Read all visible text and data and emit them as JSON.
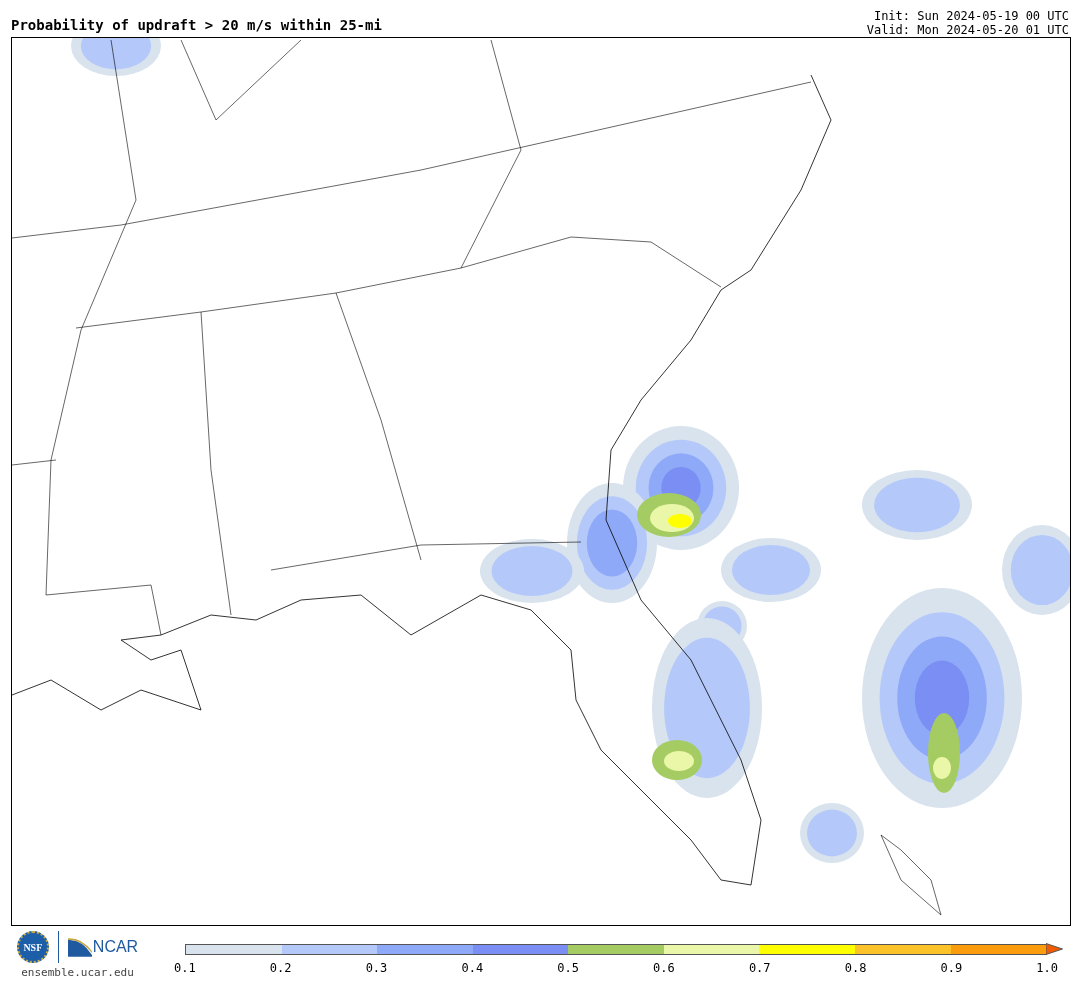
{
  "title": "Probability of updraft > 20 m/s within 25-mi",
  "init": "Init: Sun 2024-05-19 00 UTC",
  "valid": "Valid: Mon 2024-05-20 01 UTC",
  "footer": {
    "nsf_logo": "NSF",
    "ncar_logo": "NCAR",
    "url": "ensemble.ucar.edu"
  },
  "colorbar": {
    "bins": [
      {
        "color": "#d8e3ee"
      },
      {
        "color": "#b4c8fa"
      },
      {
        "color": "#8ea9f7"
      },
      {
        "color": "#7b8ef3"
      },
      {
        "color": "#a5cc62"
      },
      {
        "color": "#eaf7a8"
      },
      {
        "color": "#ffff00"
      },
      {
        "color": "#fcc22a"
      },
      {
        "color": "#fb9c0c"
      },
      {
        "kind": "extend",
        "color": "#f05a00"
      }
    ],
    "ticks": [
      "0.1",
      "0.2",
      "0.3",
      "0.4",
      "0.5",
      "0.6",
      "0.7",
      "0.8",
      "0.9",
      "1.0"
    ]
  }
}
